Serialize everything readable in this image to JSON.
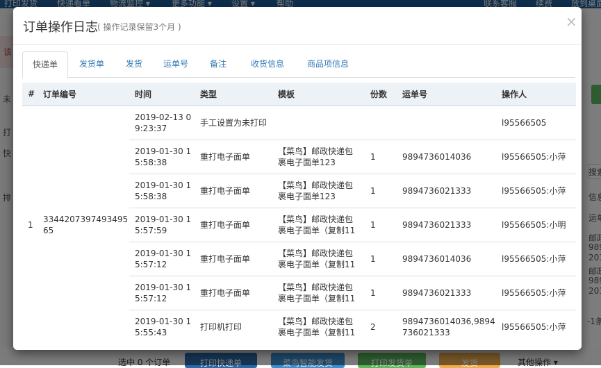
{
  "background": {
    "nav": [
      "打印发货",
      "快递看单",
      "物流监控 ▾",
      "更多功能 ▾",
      "设置 ▾",
      "帮助",
      "联系客服",
      "续费",
      "放到桌面"
    ],
    "left_texts": [
      "该",
      "未",
      "打",
      "快",
      "排"
    ],
    "right_texts": [
      "搜索",
      "信息",
      "运单",
      "邮政",
      "989",
      "201",
      "邮政",
      "989",
      "201",
      "-1条"
    ],
    "selected_count": "选中 0 个订单",
    "bottom_buttons": [
      {
        "label": "打印快递单",
        "color": "#2a6aa8"
      },
      {
        "label": "菜鸟智能发货",
        "color": "#3c8fd1"
      },
      {
        "label": "打印发货单",
        "color": "#5cb85c"
      },
      {
        "label": "发货",
        "color": "#f0ad4e"
      }
    ],
    "more_ops": "其他操作 ▾"
  },
  "modal": {
    "title": "订单操作日志",
    "subtitle": "( 操作记录保留3个月 )",
    "close_icon": "×",
    "tabs": [
      "快递单",
      "发货单",
      "发货",
      "运单号",
      "备注",
      "收货信息",
      "商品项信息"
    ],
    "active_tab": 0,
    "table": {
      "headers": [
        "#",
        "订单编号",
        "时间",
        "类型",
        "模板",
        "份数",
        "运单号",
        "操作人"
      ],
      "index": "1",
      "order_no": "334420739749349565",
      "rows": [
        {
          "time": "2019-02-13 09:23:37",
          "type": "手工设置为未打印",
          "template": "",
          "copies": "",
          "waybill": "",
          "operator": "l95566505"
        },
        {
          "time": "2019-01-30 15:58:38",
          "type": "重打电子面单",
          "template": "【菜鸟】邮政快递包裹电子面单123",
          "copies": "1",
          "waybill": "9894736014036",
          "operator": "l95566505:小萍"
        },
        {
          "time": "2019-01-30 15:58:38",
          "type": "重打电子面单",
          "template": "【菜鸟】邮政快递包裹电子面单123",
          "copies": "1",
          "waybill": "9894736021333",
          "operator": "l95566505:小萍"
        },
        {
          "time": "2019-01-30 15:57:59",
          "type": "重打电子面单",
          "template": "【菜鸟】邮政快递包裹电子面单（复制11",
          "copies": "1",
          "waybill": "9894736021333",
          "operator": "l95566505:小明"
        },
        {
          "time": "2019-01-30 15:57:12",
          "type": "重打电子面单",
          "template": "【菜鸟】邮政快递包裹电子面单（复制11",
          "copies": "1",
          "waybill": "9894736014036",
          "operator": "l95566505:小萍"
        },
        {
          "time": "2019-01-30 15:57:12",
          "type": "重打电子面单",
          "template": "【菜鸟】邮政快递包裹电子面单（复制11",
          "copies": "1",
          "waybill": "9894736021333",
          "operator": "l95566505:小萍"
        },
        {
          "time": "2019-01-30 15:55:43",
          "type": "打印机打印",
          "template": "【菜鸟】邮政快递包裹电子面单（复制11",
          "copies": "2",
          "waybill": "9894736014036,9894736021333",
          "operator": "l95566505:小萍"
        }
      ]
    }
  }
}
